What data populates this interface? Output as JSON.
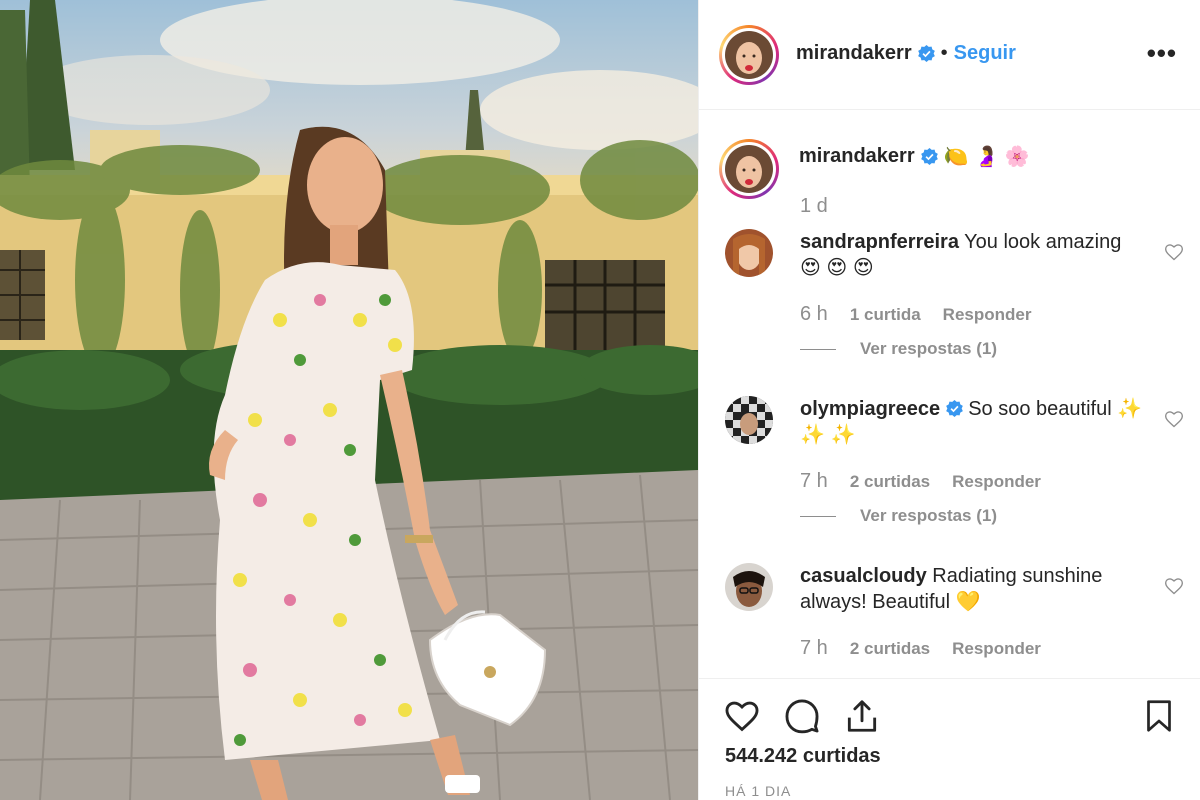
{
  "post": {
    "image_alt": "Pregnant woman in floral dress walking on cobblestones"
  },
  "header": {
    "username": "mirandakerr",
    "separator": "•",
    "follow_label": "Seguir",
    "more_label": "•••",
    "avatar_icon": "profile-avatar",
    "verified_icon": "verified-badge-icon",
    "follow_color": "#3897f0"
  },
  "caption": {
    "username": "mirandakerr",
    "emojis": "🍋 🤰 🌸",
    "time": "1 d"
  },
  "comments": [
    {
      "username": "sandrapnferreira",
      "text": "You look amazing 😍 😍 😍",
      "time": "6 h",
      "likes": "1 curtida",
      "reply": "Responder",
      "replies": "Ver respostas (1)",
      "verified": false
    },
    {
      "username": "olympiagreece",
      "text": "So soo beautiful ✨ ✨ ✨",
      "time": "7 h",
      "likes": "2 curtidas",
      "reply": "Responder",
      "replies": "Ver respostas (1)",
      "verified": true
    },
    {
      "username": "casualcloudy",
      "text": "Radiating sunshine always! Beautiful 💛",
      "time": "7 h",
      "likes": "2 curtidas",
      "reply": "Responder",
      "verified": false
    }
  ],
  "footer": {
    "likes_count": "544.242 curtidas",
    "date": "HÁ 1 DIA",
    "icons": [
      "heart-icon",
      "comment-icon",
      "share-icon",
      "bookmark-icon"
    ]
  }
}
